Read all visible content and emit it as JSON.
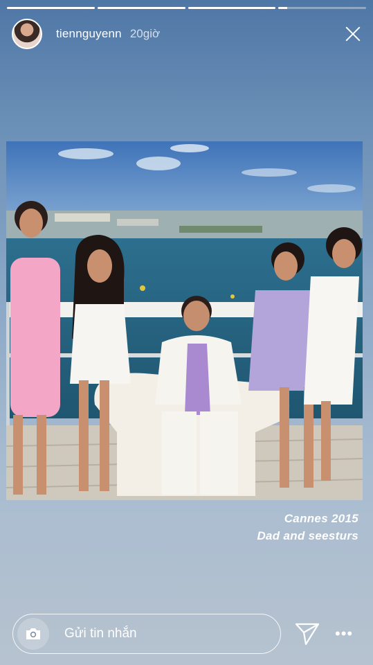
{
  "story": {
    "progress": [
      1.0,
      1.0,
      1.0,
      0.1
    ],
    "username": "tiennguyenn",
    "time_ago": "20giờ",
    "caption_lines": [
      "Cannes 2015",
      "Dad and seesturs"
    ]
  },
  "reply_bar": {
    "placeholder": "Gửi tin nhắn"
  },
  "icons": {
    "close": "close-icon",
    "camera": "camera-icon",
    "send": "send-icon",
    "more": "more-icon"
  },
  "colors": {
    "sky_top": "#4f77a6",
    "sea": "#2f6a8a"
  }
}
